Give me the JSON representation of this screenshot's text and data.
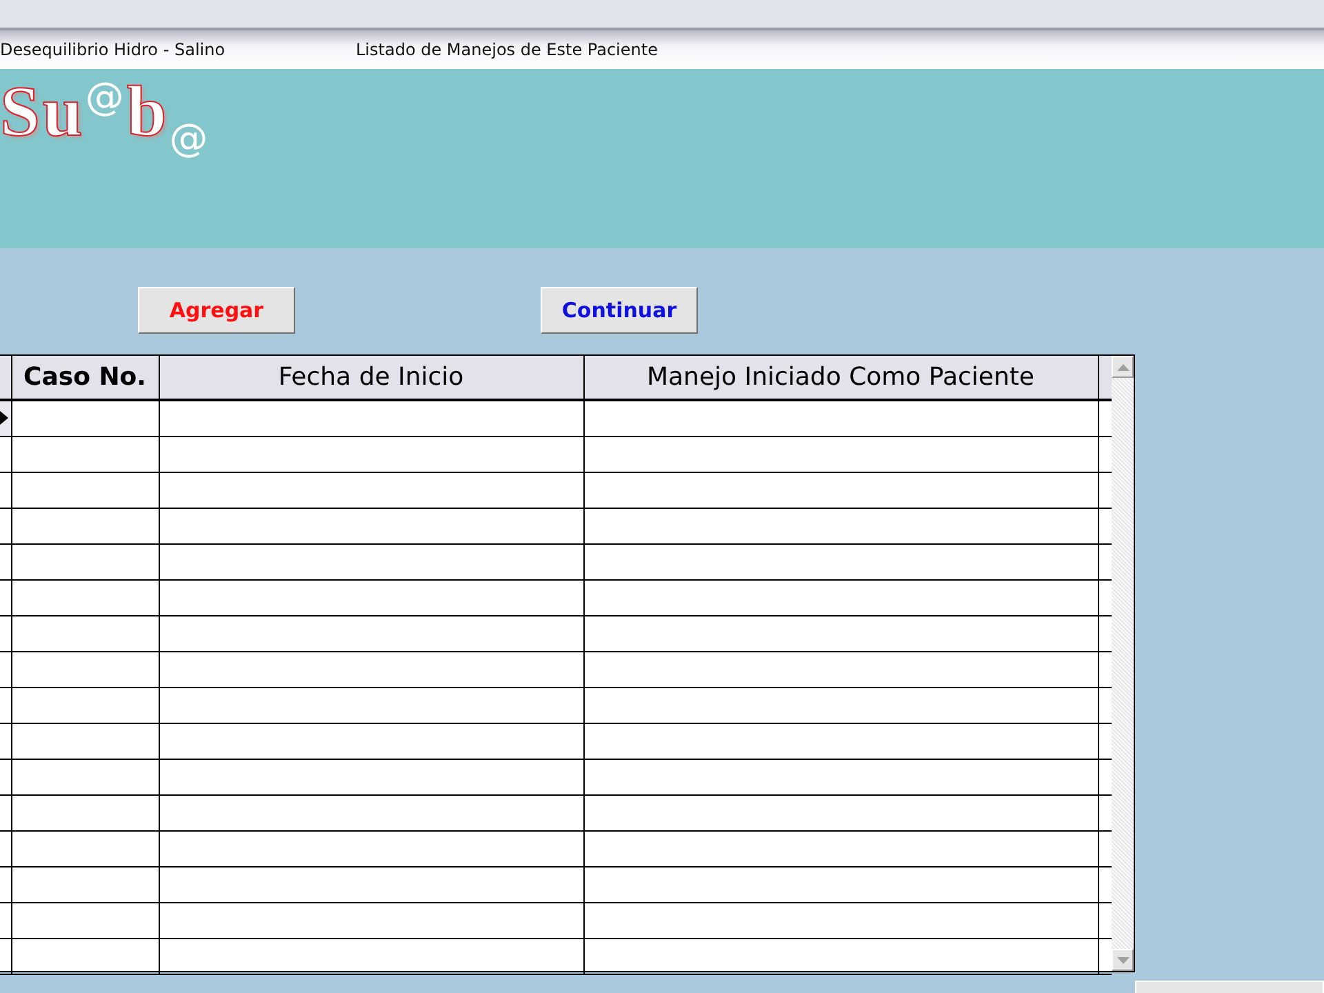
{
  "tabs": [
    {
      "label": "Desequilibrio Hidro - Salino"
    },
    {
      "label": "Listado de Manejos de Este Paciente"
    }
  ],
  "logo": {
    "text": "Su$^{@}$b$_{@}$"
  },
  "buttons": [
    {
      "label": "Agregar",
      "kind": "add"
    },
    {
      "label": "Continuar",
      "kind": "continue"
    }
  ],
  "table": {
    "columns": [
      "Caso No.",
      "Fecha de Inicio",
      "Manejo Iniciado Como Paciente"
    ],
    "rows": [
      {
        "current": true
      },
      {
        "current": false
      },
      {
        "current": false
      },
      {
        "current": false
      },
      {
        "current": false
      },
      {
        "current": false
      },
      {
        "current": false
      },
      {
        "current": false
      },
      {
        "current": false
      },
      {
        "current": false
      },
      {
        "current": false
      },
      {
        "current": false
      },
      {
        "current": false
      },
      {
        "current": false
      },
      {
        "current": false
      },
      {
        "current": false
      }
    ]
  }
}
